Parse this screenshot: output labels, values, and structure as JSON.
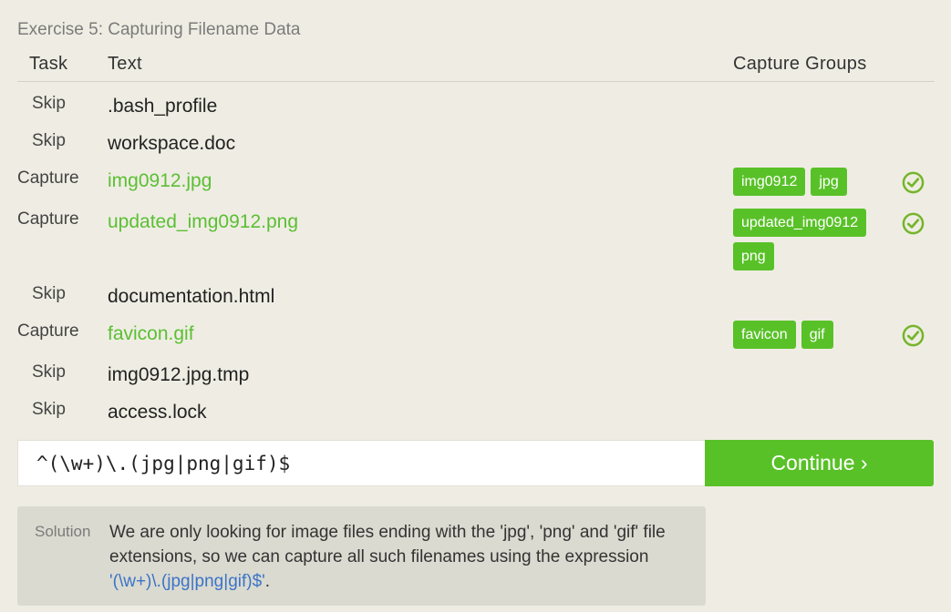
{
  "exercise": {
    "title": "Exercise 5: Capturing Filename Data"
  },
  "table": {
    "headers": {
      "task": "Task",
      "text": "Text",
      "groups": "Capture Groups"
    },
    "rows": [
      {
        "task": "Skip",
        "text": ".bash_profile",
        "groups": []
      },
      {
        "task": "Skip",
        "text": "workspace.doc",
        "groups": []
      },
      {
        "task": "Capture",
        "text": "img0912.jpg",
        "groups": [
          "img0912",
          "jpg"
        ],
        "status": "check-circle-icon"
      },
      {
        "task": "Capture",
        "text": "updated_img0912.png",
        "groups": [
          "updated_img0912",
          "png"
        ],
        "status": "check-circle-icon"
      },
      {
        "task": "Skip",
        "text": "documentation.html",
        "groups": []
      },
      {
        "task": "Capture",
        "text": "favicon.gif",
        "groups": [
          "favicon",
          "gif"
        ],
        "status": "check-circle-icon"
      },
      {
        "task": "Skip",
        "text": "img0912.jpg.tmp",
        "groups": []
      },
      {
        "task": "Skip",
        "text": "access.lock",
        "groups": []
      }
    ]
  },
  "input": {
    "value": "^(\\w+)\\.(jpg|png|gif)$"
  },
  "continue_button": {
    "label": "Continue ›"
  },
  "solution": {
    "label": "Solution",
    "text": "We are only looking for image files ending with the 'jpg', 'png' and 'gif' file extensions, so we can capture all such filenames using the expression",
    "expression": "'(\\w+)\\.(jpg|png|gif)$'",
    "suffix": "."
  },
  "colors": {
    "background": "#efede3",
    "accent_green": "#59c128",
    "match_text": "#5bbf34",
    "link_blue": "#3b73c8"
  }
}
